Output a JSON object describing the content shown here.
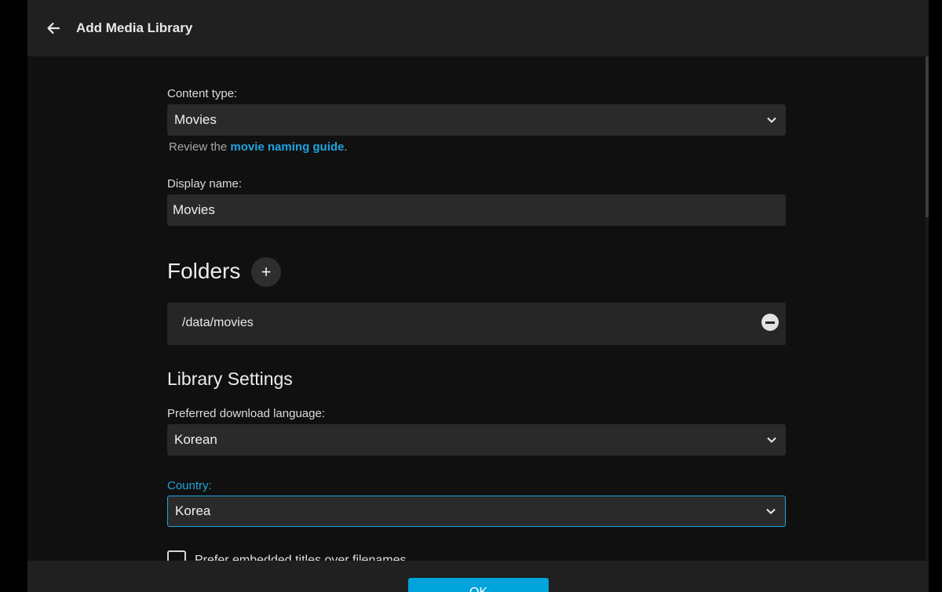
{
  "header": {
    "title": "Add Media Library",
    "back_icon": "arrow-left-icon"
  },
  "form": {
    "content_type": {
      "label": "Content type:",
      "value": "Movies",
      "helper_prefix": "Review the ",
      "helper_link": "movie naming guide",
      "helper_suffix": "."
    },
    "display_name": {
      "label": "Display name:",
      "value": "Movies"
    },
    "folders": {
      "title": "Folders",
      "add_icon": "+",
      "items": [
        {
          "path": "/data/movies"
        }
      ]
    },
    "library_settings": {
      "title": "Library Settings",
      "preferred_language": {
        "label": "Preferred download language:",
        "value": "Korean"
      },
      "country": {
        "label": "Country:",
        "value": "Korea"
      },
      "embedded_titles": {
        "label": "Prefer embedded titles over filenames",
        "checked": false
      }
    }
  },
  "footer": {
    "ok_label": "OK"
  },
  "colors": {
    "accent": "#00a4dc",
    "link": "#1fa4e0",
    "background": "#101010",
    "header": "#202020"
  }
}
